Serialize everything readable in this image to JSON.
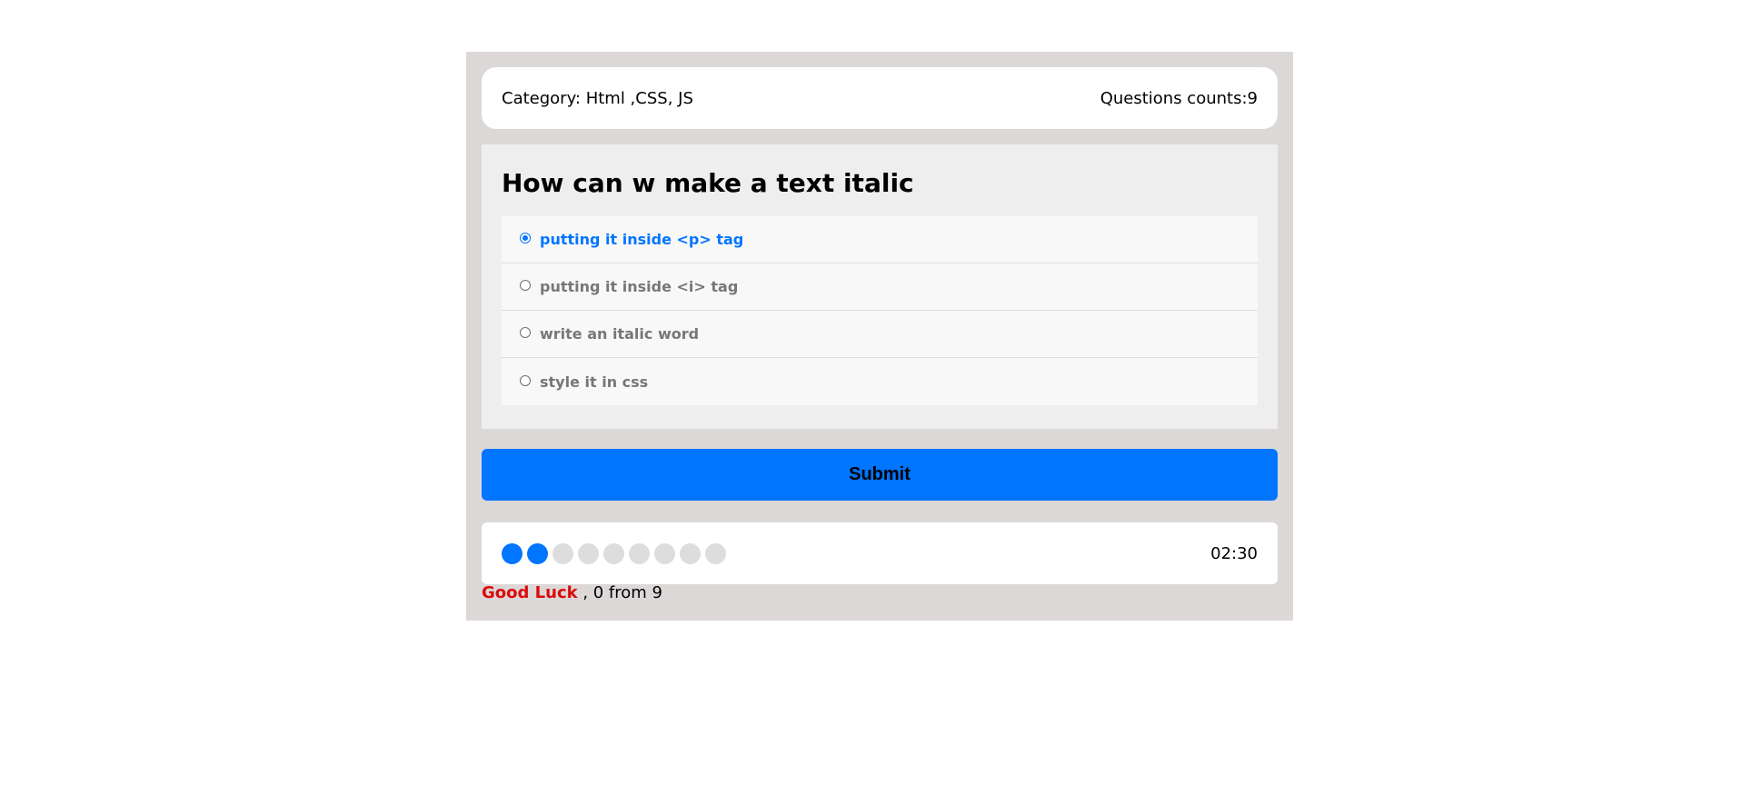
{
  "info": {
    "category_label": "Category: ",
    "category_value": "Html ,CSS, JS",
    "count_label": "Questions counts:",
    "count_value": "9"
  },
  "question": {
    "title": "How can w make a text italic",
    "answers": [
      {
        "label": "putting it inside <p> tag",
        "selected": true
      },
      {
        "label": "putting it inside <i> tag",
        "selected": false
      },
      {
        "label": "write an italic word",
        "selected": false
      },
      {
        "label": "style it in css",
        "selected": false
      }
    ]
  },
  "submit_label": "Submit",
  "progress": {
    "total": 9,
    "current": 2,
    "active_color": "#0075ff",
    "inactive_color": "#dddddd"
  },
  "countdown": "02:30",
  "results": {
    "status": "Good Luck",
    "status_color": "#dc0a0a",
    "score_text": " , 0 from 9"
  },
  "colors": {
    "accent": "#0075ff",
    "frame_bg": "#dcd8d8",
    "quiz_area_bg": "#eeeeee"
  }
}
